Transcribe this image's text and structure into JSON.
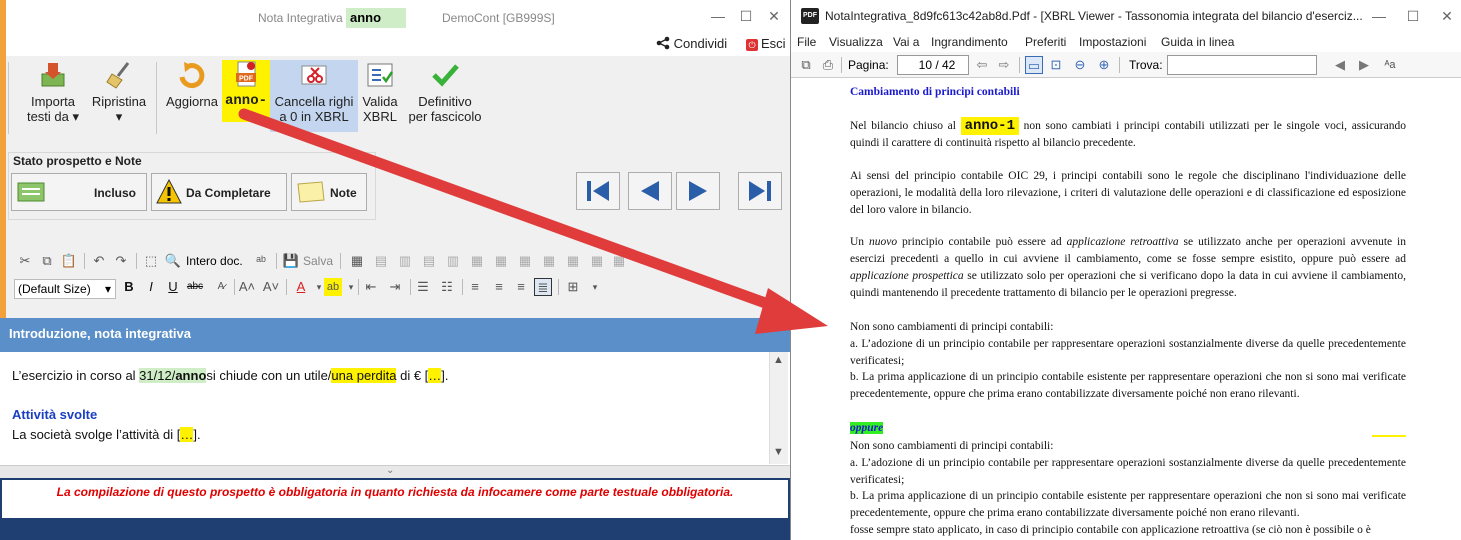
{
  "left": {
    "title": {
      "app": "Nota Integrativa",
      "highlight": "anno",
      "company": "DemoCont [GB999S]"
    },
    "share_label": "Condividi",
    "exit_label": "Esci",
    "ribbon": {
      "importa": {
        "line1": "Importa",
        "line2": "testi da"
      },
      "ripristina": {
        "line1": "Ripristina"
      },
      "aggiorna": {
        "line1": "Aggiorna"
      },
      "anno": {
        "line1": "anno-1"
      },
      "cancella": {
        "line1": "Cancella righi",
        "line2": "a 0 in XBRL"
      },
      "valida": {
        "line1": "Valida",
        "line2": "XBRL"
      },
      "definitivo": {
        "line1": "Definitivo",
        "line2": "per fascicolo"
      }
    },
    "stato": {
      "title": "Stato prospetto e Note",
      "incluso": "Incluso",
      "da_completare": "Da Completare",
      "note": "Note"
    },
    "toolbar": {
      "intero_doc": "Intero doc.",
      "salva": "Salva",
      "font_size": "(Default Size)"
    },
    "section_title": "Introduzione, nota integrativa",
    "editor": {
      "line1_a": "L’esercizio in corso al ",
      "line1_date": "31/12/",
      "line1_anno": "anno",
      "line1_b": "si chiude con un utile/",
      "line1_perdita": "una perdita",
      "line1_c": " di € [",
      "line1_dots": "…",
      "line1_d": "].",
      "heading": "Attività svolte",
      "line2_a": "La società svolge l’attività di [",
      "line2_dots": "…",
      "line2_b": "]."
    },
    "notice": "La compilazione di questo prospetto è obbligatoria in quanto richiesta da infocamere come parte testuale obbligatoria."
  },
  "right": {
    "title": "NotaIntegrativa_8d9fc613c42ab8d.Pdf - [XBRL Viewer - Tassonomia integrata del bilancio d'eserciz...",
    "menu": [
      "File",
      "Visualizza",
      "Vai a",
      "Ingrandimento",
      "Preferiti",
      "Impostazioni",
      "Guida in linea"
    ],
    "toolbar": {
      "pagina_label": "Pagina:",
      "page_current": "10",
      "page_total": "/ 42",
      "trova_label": "Trova:"
    },
    "page": {
      "heading": "Cambiamento di principi contabili",
      "p1_a": "Nel bilancio chiuso al ",
      "p1_anno": "anno-1",
      "p1_b": " non sono cambiati i principi contabili utilizzati per le singole voci, assicurando quindi il carattere di continuità rispetto al bilancio precedente.",
      "p2": "Ai sensi del principio contabile OIC 29, i principi contabili sono le regole che disciplinano l'individuazione delle operazioni, le modalità della loro rilevazione, i criteri di valutazione delle operazioni e di classificazione ed esposizione del loro valore in bilancio.",
      "p3_a": "Un ",
      "p3_nuovo": "nuovo",
      "p3_b": " principio contabile può essere ad ",
      "p3_retro": "applicazione retroattiva",
      "p3_c": " se utilizzato anche per operazioni avvenute in esercizi precedenti a quello in cui avviene il cambiamento, come se fosse sempre esistito, oppure può essere ad ",
      "p3_prosp": "applicazione prospettica",
      "p3_d": " se utilizzato solo per operazioni che si verificano dopo la data in cui avviene il cambiamento, quindi mantenendo il precedente trattamento di bilancio per le operazioni pregresse.",
      "p4_title": "Non sono cambiamenti di principi contabili:",
      "p4_a": "a. L’adozione di un principio contabile per rappresentare operazioni sostanzialmente diverse da quelle precedentemente verificatesi;",
      "p4_b": "b. La prima applicazione di un principio contabile esistente per rappresentare operazioni che non si sono mai verificate precedentemente, oppure che prima erano contabilizzate diversamente poiché non erano rilevanti.",
      "oppure": "oppure",
      "p5_title": "Non sono cambiamenti di principi contabili:",
      "p5_a": "a. L’adozione di un principio contabile per rappresentare operazioni sostanzialmente diverse da quelle precedentemente verificatesi;",
      "p5_b": "b. La prima applicazione di un principio contabile esistente per rappresentare operazioni che non si sono mai verificate precedentemente, oppure che prima erano contabilizzate diversamente poiché non erano rilevanti.",
      "p6": "fosse sempre stato applicato, in caso di principio contabile con applicazione retroattiva (se ciò non è possibile o è"
    }
  },
  "colors": {
    "accent_blue": "#5b8fc9",
    "arrow_red": "#e03c3c",
    "highlight_yellow": "#fff200",
    "highlight_green": "#cfeec7"
  }
}
